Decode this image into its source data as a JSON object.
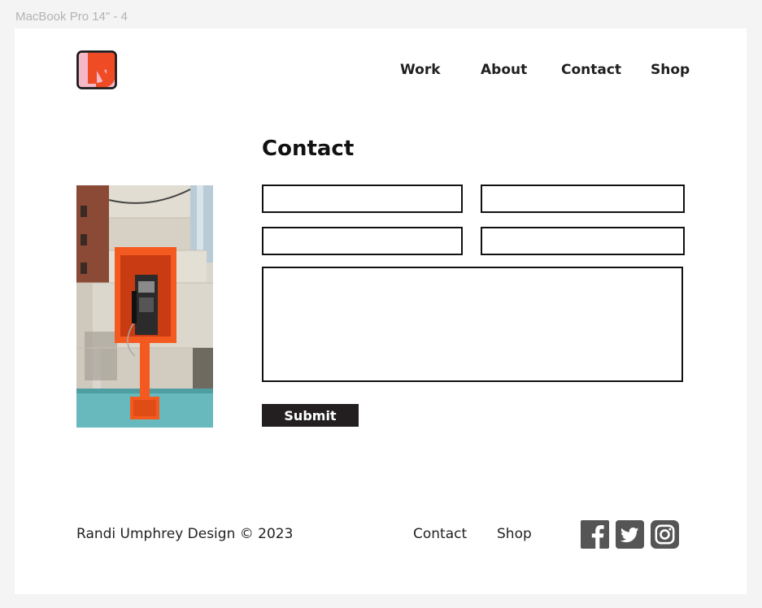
{
  "frame": {
    "label": "MacBook Pro 14\" - 4"
  },
  "brand": {
    "logo": "RU"
  },
  "nav": {
    "items": [
      "Work",
      "About",
      "Contact",
      "Shop"
    ]
  },
  "main": {
    "title": "Contact",
    "form": {
      "fields": [
        {
          "value": "",
          "placeholder": ""
        },
        {
          "value": "",
          "placeholder": ""
        },
        {
          "value": "",
          "placeholder": ""
        },
        {
          "value": "",
          "placeholder": ""
        }
      ],
      "message": {
        "value": "",
        "placeholder": ""
      },
      "submit_label": "Submit"
    }
  },
  "footer": {
    "copyright": "Randi Umphrey Design © 2023",
    "links": [
      "Contact",
      "Shop"
    ],
    "social": [
      "facebook-icon",
      "twitter-icon",
      "instagram-icon"
    ]
  },
  "colors": {
    "logo_pink": "#f4b8c6",
    "logo_orange": "#ef4b25",
    "payphone_orange": "#f45a1f",
    "button_dark": "#231f20",
    "social_gray": "#555555"
  }
}
